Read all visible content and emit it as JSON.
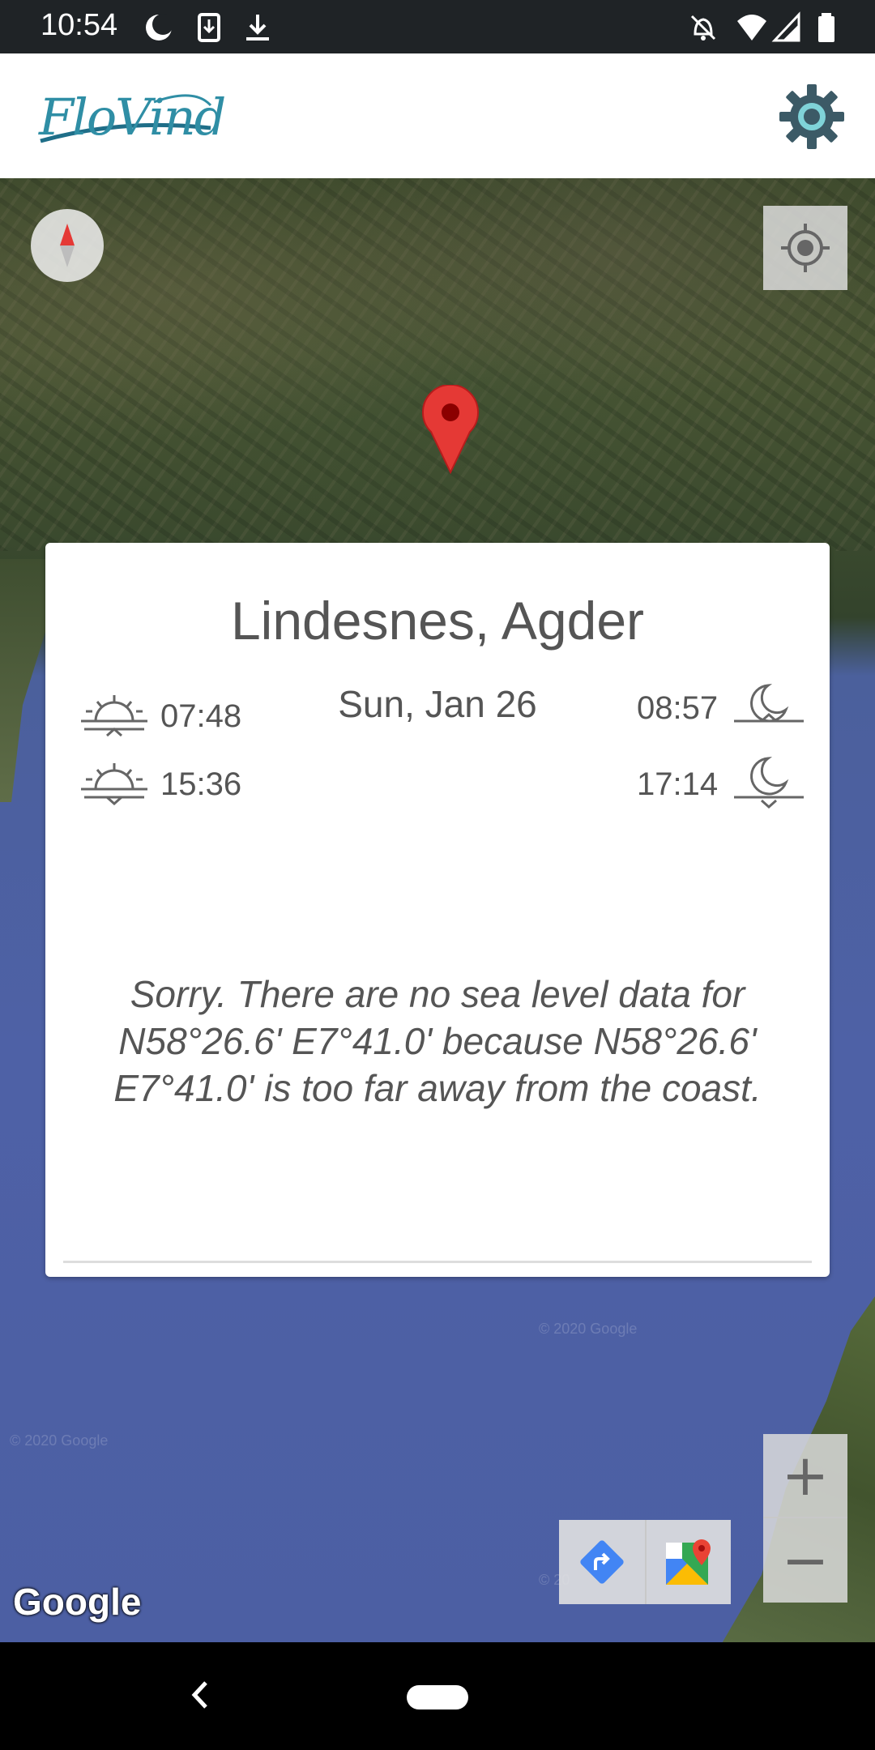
{
  "status_bar": {
    "time": "10:54"
  },
  "app_bar": {
    "logo_text": "FloVind",
    "settings_icon": "gear-icon"
  },
  "map": {
    "compass_icon": "compass-icon",
    "my_location_icon": "crosshair-icon",
    "pin_icon": "map-pin-icon",
    "watermarks": [
      "© 2020 Google",
      "© 2020 Google",
      "© 20"
    ],
    "attribution": "Google"
  },
  "card": {
    "location": "Lindesnes, Agder",
    "date": "Sun, Jan 26",
    "sunrise": "07:48",
    "sunset": "15:36",
    "moonrise": "08:57",
    "moonset": "17:14",
    "message": "Sorry. There are no sea level data for N58°26.6'  E7°41.0' because N58°26.6' E7°41.0' is too far away from the coast."
  },
  "zoom": {
    "in_label": "+",
    "out_label": "−"
  },
  "toolbar": {
    "directions_icon": "directions-icon",
    "maps_icon": "google-maps-icon"
  },
  "colors": {
    "accent": "#2f8ea5",
    "pin": "#e53935",
    "directions": "#4285f4"
  }
}
